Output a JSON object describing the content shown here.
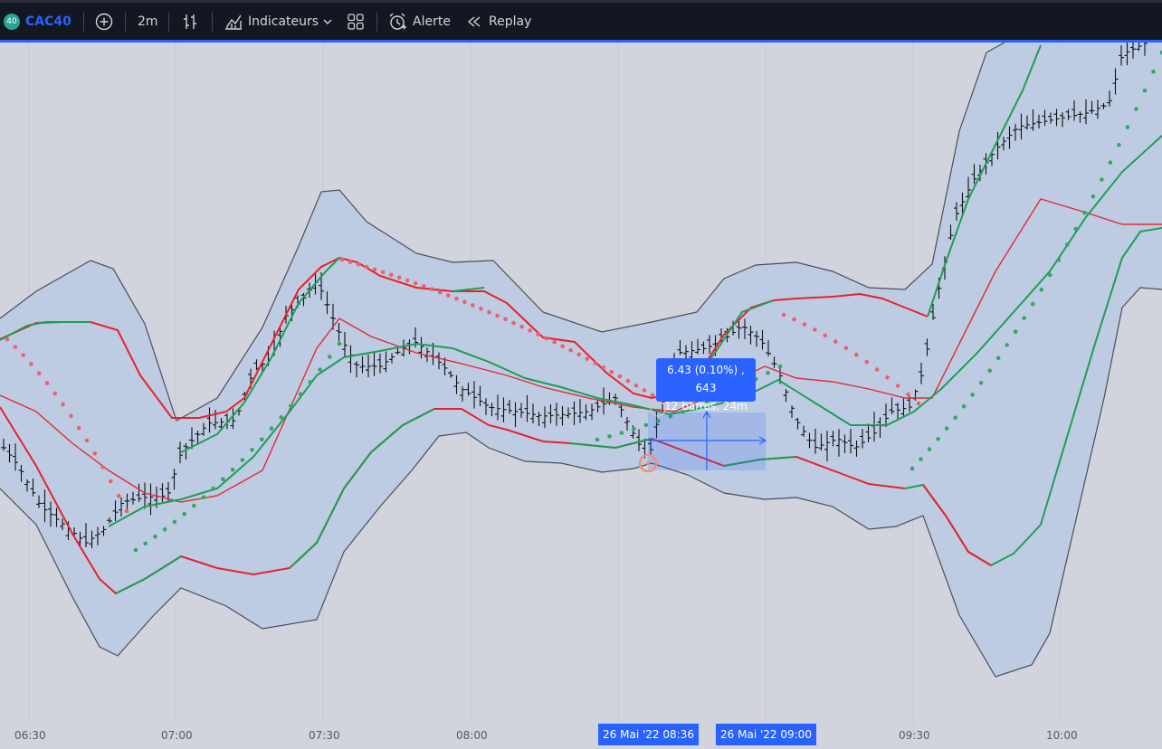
{
  "toolbar": {
    "symbol_badge": "40",
    "symbol": "CAC40",
    "interval": "2m",
    "indicators_label": "Indicateurs",
    "alert_label": "Alerte",
    "replay_label": "Replay"
  },
  "colors": {
    "toolbar_bg": "#131722",
    "chart_bg": "#d1d4dc",
    "accent": "#2962ff",
    "band_fill": "#b7c9e6",
    "outer_band": "#4a4e58",
    "bb_up": "#1f9d55",
    "bb_down": "#e8222a",
    "psar_bear": "#ef5f6b",
    "psar_bull": "#32a864",
    "bar_color": "#111111"
  },
  "measure": {
    "line1": "6.43 (0.10%) , 643",
    "line2": "12 barres, 24m"
  },
  "time_axis": {
    "ticks": [
      "06:30",
      "07:00",
      "07:30",
      "08:00",
      "09:30",
      "10:00"
    ],
    "start_label": "26 Mai '22    08:36",
    "end_label": "26 Mai '22    09:00"
  },
  "chart_data": {
    "type": "ohlc",
    "symbol": "CAC40",
    "interval": "2m",
    "indicators": [
      "Bollinger Bands",
      "Parabolic SAR"
    ]
  }
}
